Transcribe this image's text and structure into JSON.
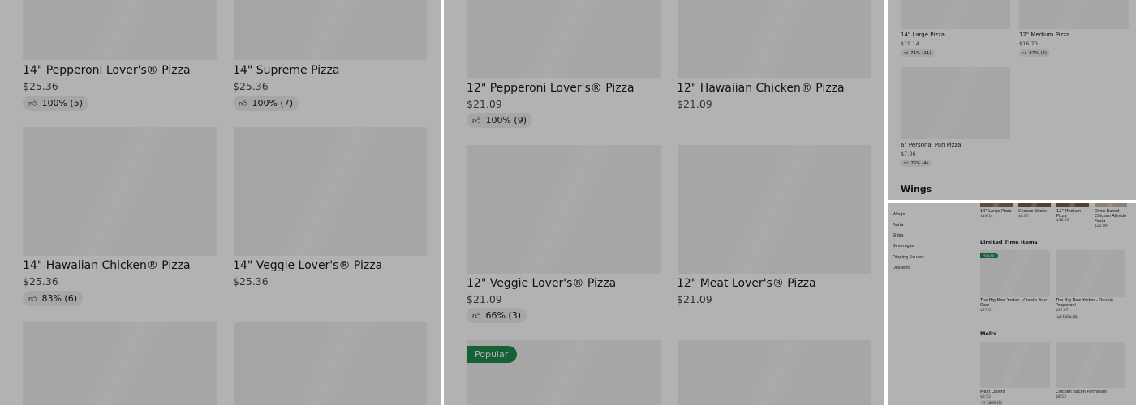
{
  "panel1": {
    "items": [
      {
        "name": "14\" Pepperoni Lover's® Pizza",
        "price": "$25.36",
        "rating": "100% (5)"
      },
      {
        "name": "14\" Supreme Pizza",
        "price": "$25.36",
        "rating": "100% (7)"
      },
      {
        "name": "14\" Hawaiian Chicken® Pizza",
        "price": "$25.36",
        "rating": "83% (6)"
      },
      {
        "name": "14\" Veggie Lover's® Pizza",
        "price": "$25.36"
      }
    ]
  },
  "panel2": {
    "items": [
      {
        "name": "12\" Pepperoni Lover's® Pizza",
        "price": "$21.09",
        "rating": "100% (9)"
      },
      {
        "name": "12\" Hawaiian Chicken® Pizza",
        "price": "$21.09"
      },
      {
        "name": "12\" Veggie Lover's® Pizza",
        "price": "$21.09",
        "rating": "66% (3)"
      },
      {
        "name": "12\" Meat Lover's® Pizza",
        "price": "$21.09"
      }
    ],
    "popular_badge": "Popular"
  },
  "panel3": {
    "items": [
      {
        "name": "14\" Large Pizza",
        "price": "$19.14",
        "rating": "71% (21)"
      },
      {
        "name": "12\" Medium Pizza",
        "price": "$16.70",
        "rating": "87% (8)"
      },
      {
        "name": "6\" Personal Pan Pizza",
        "price": "$7.06",
        "rating": "75% (4)"
      }
    ],
    "section_heading": "Wings"
  },
  "panel4": {
    "sidebar": [
      "Wings",
      "Pasta",
      "Sides",
      "Beverages",
      "Dipping Sauces",
      "Desserts"
    ],
    "top_row": [
      {
        "name": "14\" Large Pizza",
        "price": "$19.14"
      },
      {
        "name": "Cheese Sticks",
        "price": "$8.87"
      },
      {
        "name": "12\" Medium Pizza",
        "price": "$16.70"
      },
      {
        "name": "Oven-Baked Chicken Alfredo Pasta",
        "price": "$22.09"
      }
    ],
    "limited_heading": "Limited Time Items",
    "popular_badge": "Popular",
    "limited_items": [
      {
        "name": "The Big New Yorker - Create Your Own",
        "price": "$27.07"
      },
      {
        "name": "The Big New Yorker - Double Pepperoni",
        "price": "$27.07",
        "rating": "100% (4)"
      }
    ],
    "melts_heading": "Melts",
    "melts_items": [
      {
        "name": "Meat Lovers",
        "price": "$8.53",
        "rating": "100% (9)"
      },
      {
        "name": "Chicken Bacon Parmesan",
        "price": "$8.53"
      }
    ]
  }
}
